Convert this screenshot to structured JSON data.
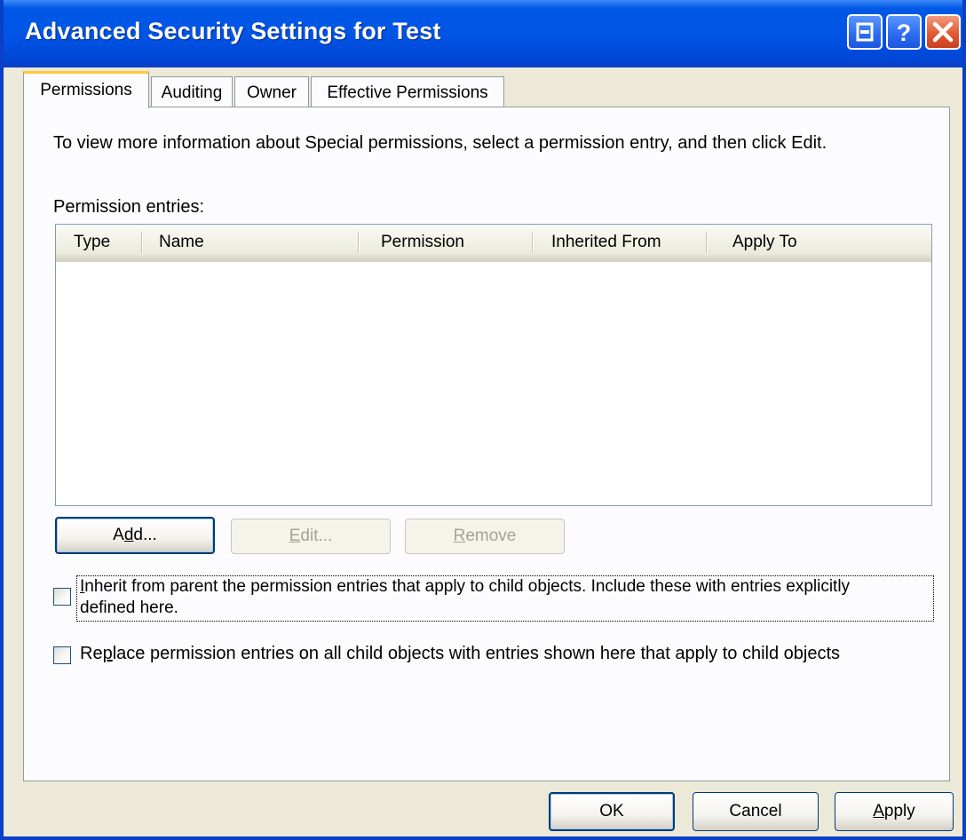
{
  "window": {
    "title": "Advanced Security Settings for Test",
    "controls": [
      "context-help-icon",
      "help-icon",
      "close-icon"
    ]
  },
  "tabs": [
    {
      "label": "Permissions",
      "active": true
    },
    {
      "label": "Auditing",
      "active": false
    },
    {
      "label": "Owner",
      "active": false
    },
    {
      "label": "Effective Permissions",
      "active": false
    }
  ],
  "permissions_tab": {
    "info_text": "To view more information about Special permissions, select a permission entry, and then click Edit.",
    "entries_label": "Permission entries:",
    "columns": [
      "Type",
      "Name",
      "Permission",
      "Inherited From",
      "Apply To"
    ],
    "rows": [],
    "buttons": {
      "add": {
        "pre": "A",
        "accel": "d",
        "post": "d...",
        "enabled": true
      },
      "edit": {
        "pre": "",
        "accel": "E",
        "post": "dit...",
        "enabled": false
      },
      "remove": {
        "pre": "",
        "accel": "R",
        "post": "emove",
        "enabled": false
      }
    },
    "inherit_checkbox": {
      "accel": "I",
      "line1_rest": "nherit from parent the permission entries that apply to child objects. Include these with entries explicitly",
      "line2": "defined here.",
      "checked": false
    },
    "replace_checkbox": {
      "pre": "Re",
      "accel": "p",
      "post": "lace permission entries on all child objects with entries shown here that apply to child objects",
      "checked": false
    }
  },
  "footer": {
    "ok": "OK",
    "cancel": "Cancel",
    "apply_accel": "A",
    "apply_rest": "pply"
  },
  "colors": {
    "titlebar": "#0055e5",
    "face": "#ece9d8",
    "tab_active_accent": "#ffc83c"
  }
}
